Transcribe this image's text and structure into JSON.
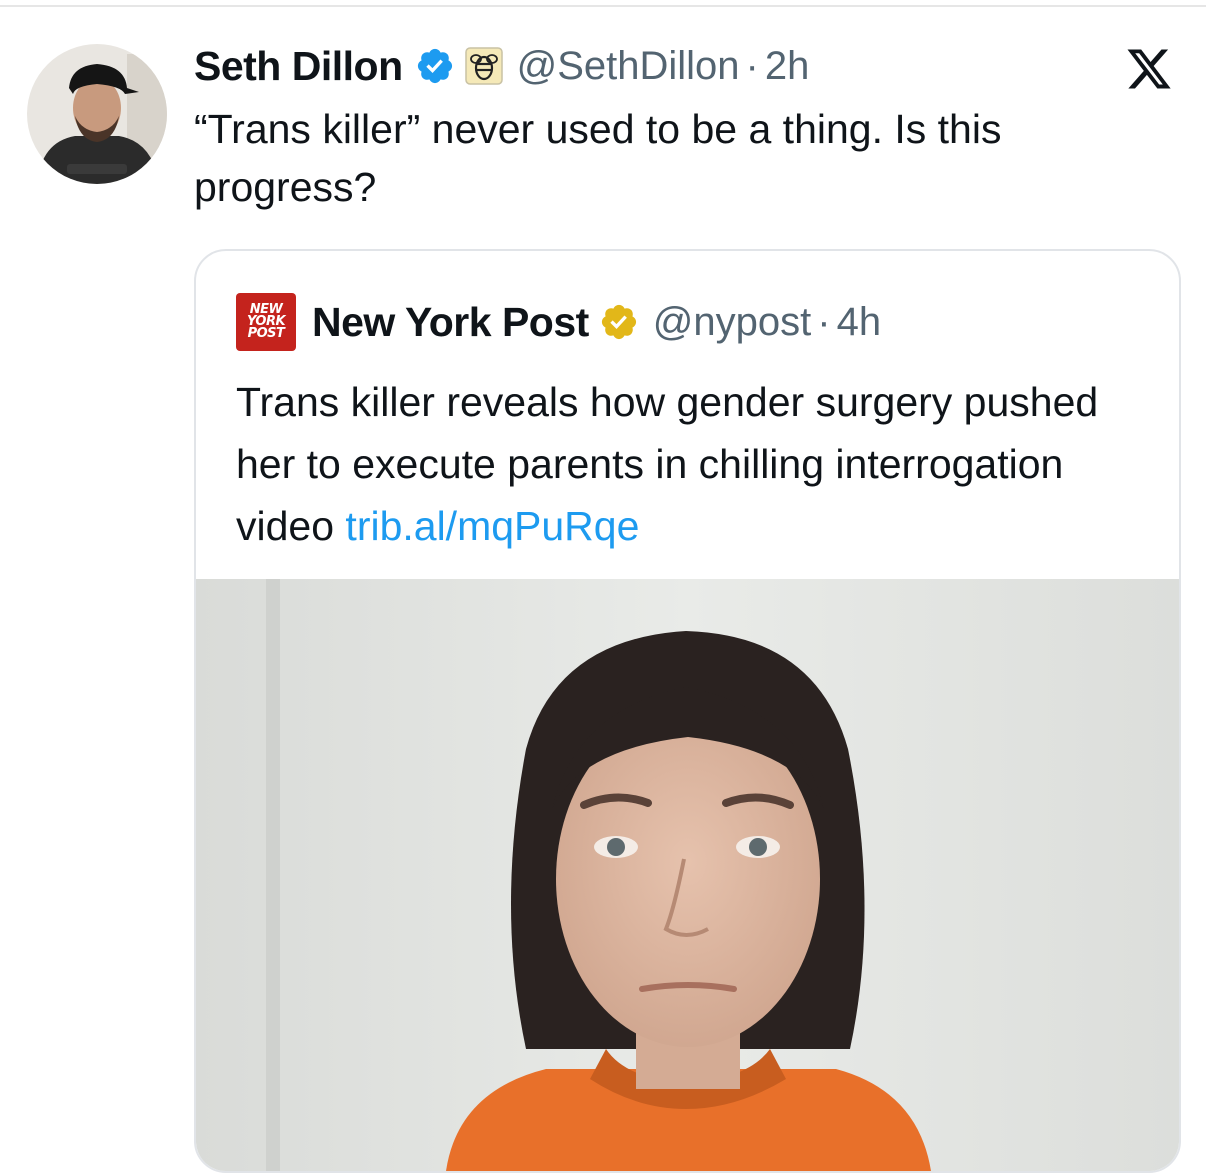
{
  "tweet": {
    "author_name": "Seth Dillon",
    "handle": "@SethDillon",
    "separator": "·",
    "time": "2h",
    "text": "“Trans killer” never used to be a thing. Is this progress?",
    "avatar_icon": "person-avatar",
    "verified_icon": "verified-badge-blue",
    "affiliation_icon": "babylon-bee-badge",
    "brand_icon": "x-logo"
  },
  "quote": {
    "author_name": "New York Post",
    "handle": "@nypost",
    "separator": "·",
    "time": "4h",
    "logo_lines": [
      "NEW",
      "YORK",
      "POST"
    ],
    "text": "Trans killer reveals how gender surgery pushed her to execute parents in chilling interrogation video ",
    "link_text": "trib.al/mqPuRqe",
    "verified_icon": "verified-badge-gold",
    "media_icon": "portrait-photo"
  },
  "colors": {
    "text": "#0f1419",
    "secondary": "#536471",
    "link": "#1d9bf0",
    "verified_blue": "#1d9bf0",
    "verified_gold": "#e2b719",
    "nypost_red": "#c4231d",
    "jumpsuit": "#e8702a"
  }
}
